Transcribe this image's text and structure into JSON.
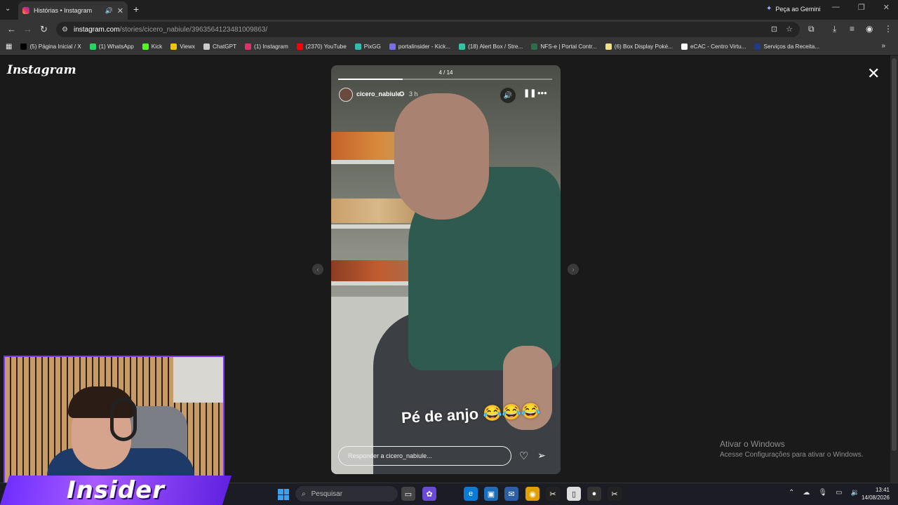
{
  "browser": {
    "tab_title": "Histórias • Instagram",
    "gemini_label": "Peça ao Gemini",
    "url_host": "instagram.com",
    "url_path": "/stories/cicero_nabiule/3963564123481009863/"
  },
  "bookmarks": [
    {
      "label": "(5) Página Inicial / X",
      "color": "#000000"
    },
    {
      "label": "(1) WhatsApp",
      "color": "#25d366"
    },
    {
      "label": "Kick",
      "color": "#53fc18"
    },
    {
      "label": "Viewx",
      "color": "#f5c400"
    },
    {
      "label": "ChatGPT",
      "color": "#cccccc"
    },
    {
      "label": "(1) Instagram",
      "color": "#e1306c"
    },
    {
      "label": "(2370) YouTube",
      "color": "#ff0000"
    },
    {
      "label": "PixGG",
      "color": "#32bcad"
    },
    {
      "label": "portalinsider - Kick...",
      "color": "#7b6cf0"
    },
    {
      "label": "(18) Alert Box / Stre...",
      "color": "#31c3a2"
    },
    {
      "label": "NFS-e | Portal Contr...",
      "color": "#2c6e49"
    },
    {
      "label": "(6) Box Display Poké...",
      "color": "#f2e085"
    },
    {
      "label": "eCAC - Centro Virtu...",
      "color": "#ffffff"
    },
    {
      "label": "Serviços da Receita...",
      "color": "#1e3a8a"
    }
  ],
  "instagram": {
    "logo": "Instagram",
    "story": {
      "counter": "4 / 14",
      "progress_fraction": 0.3,
      "username": "cicero_nabiule",
      "time": "3 h",
      "caption": "Pé de anjo 😂😂😂",
      "reply_placeholder": "Responder a cicero_nabiule..."
    }
  },
  "watermark": {
    "title": "Ativar o Windows",
    "subtitle": "Acesse Configurações para ativar o Windows."
  },
  "overlay": {
    "brand": "Insider"
  },
  "taskbar": {
    "search_placeholder": "Pesquisar",
    "time": "13:41",
    "date": "14/08/2026"
  }
}
